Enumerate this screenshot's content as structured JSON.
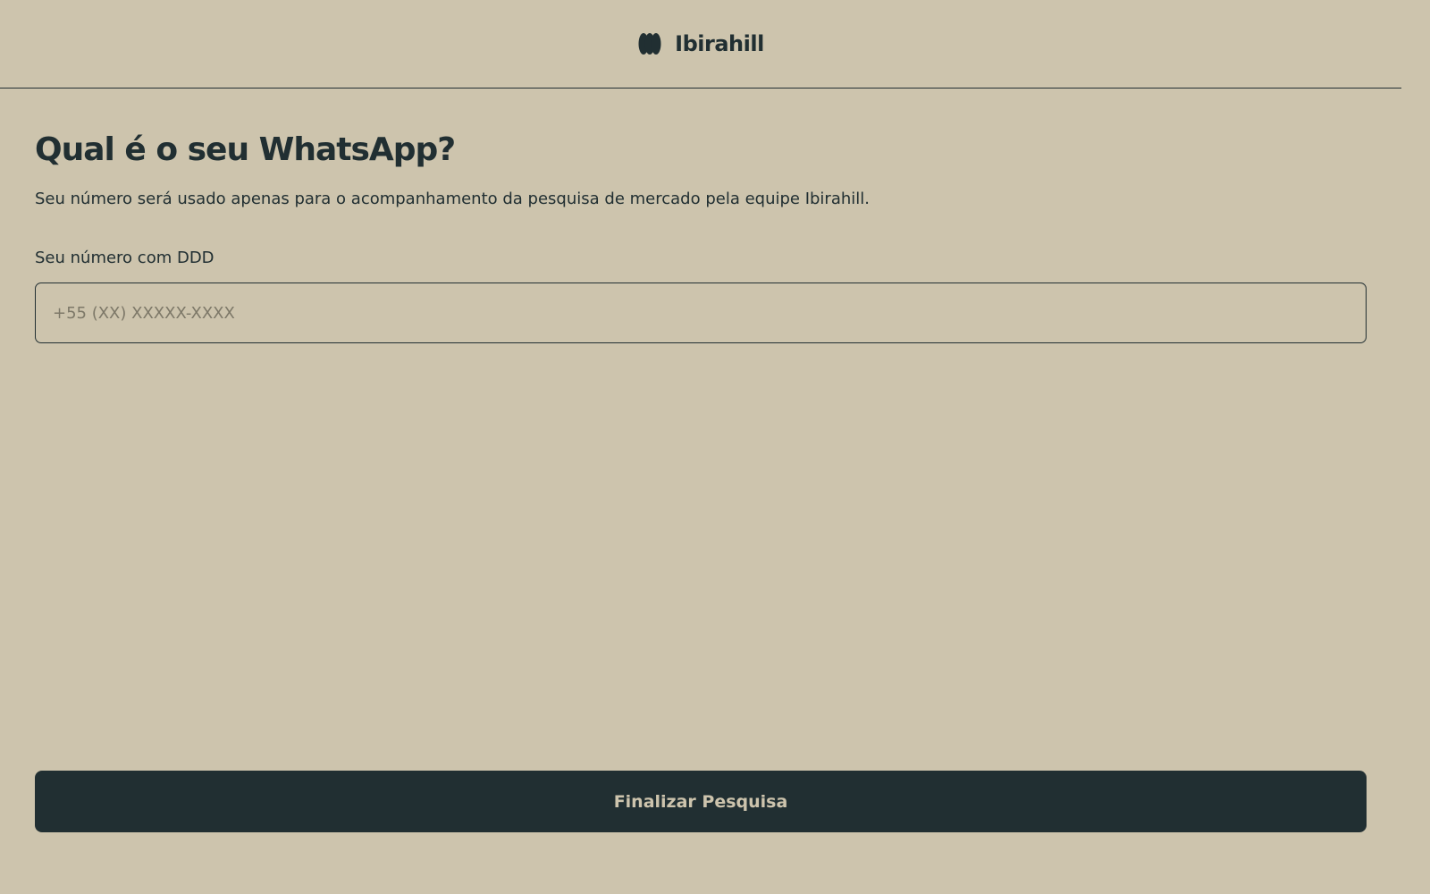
{
  "header": {
    "brand_name": "Ibirahill",
    "logo_icon": "ibirahill-logo-icon"
  },
  "main": {
    "title": "Qual é o seu WhatsApp?",
    "subtitle": "Seu número será usado apenas para o acompanhamento da pesquisa de mercado pela equipe Ibirahill.",
    "phone_field": {
      "label": "Seu número com DDD",
      "placeholder": "+55 (XX) XXXXX-XXXX",
      "value": ""
    }
  },
  "footer": {
    "submit_label": "Finalizar Pesquisa"
  },
  "colors": {
    "background": "#CDC4AD",
    "primary": "#212F32",
    "button_text": "#CDC4AD"
  }
}
